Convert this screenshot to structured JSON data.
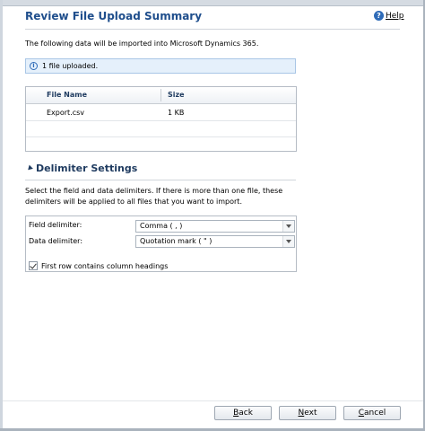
{
  "dialog": {
    "title": "Review File Upload Summary",
    "help_label": "Help",
    "intro": "The following data will be imported into Microsoft Dynamics 365.",
    "info_message": "1 file uploaded."
  },
  "files_grid": {
    "columns": [
      "File Name",
      "Size"
    ],
    "rows": [
      {
        "file_name": "Export.csv",
        "size": "1 KB"
      }
    ]
  },
  "delimiter_settings": {
    "title": "Delimiter Settings",
    "description": "Select the field and data delimiters. If there is more than one file, these delimiters will be applied to all files that you want to import.",
    "field_delimiter_label": "Field delimiter:",
    "field_delimiter_value": "Comma ( , )",
    "data_delimiter_label": "Data delimiter:",
    "data_delimiter_value": "Quotation mark ( \" )",
    "first_row_headings_label": "First row contains column headings",
    "first_row_headings_checked": true
  },
  "footer": {
    "back_label": "Back",
    "next_label": "Next",
    "cancel_label": "Cancel"
  },
  "colors": {
    "title_blue": "#1f4e8c",
    "info_bar_bg": "#e5f0fb",
    "header_text": "#1e3a5f"
  }
}
